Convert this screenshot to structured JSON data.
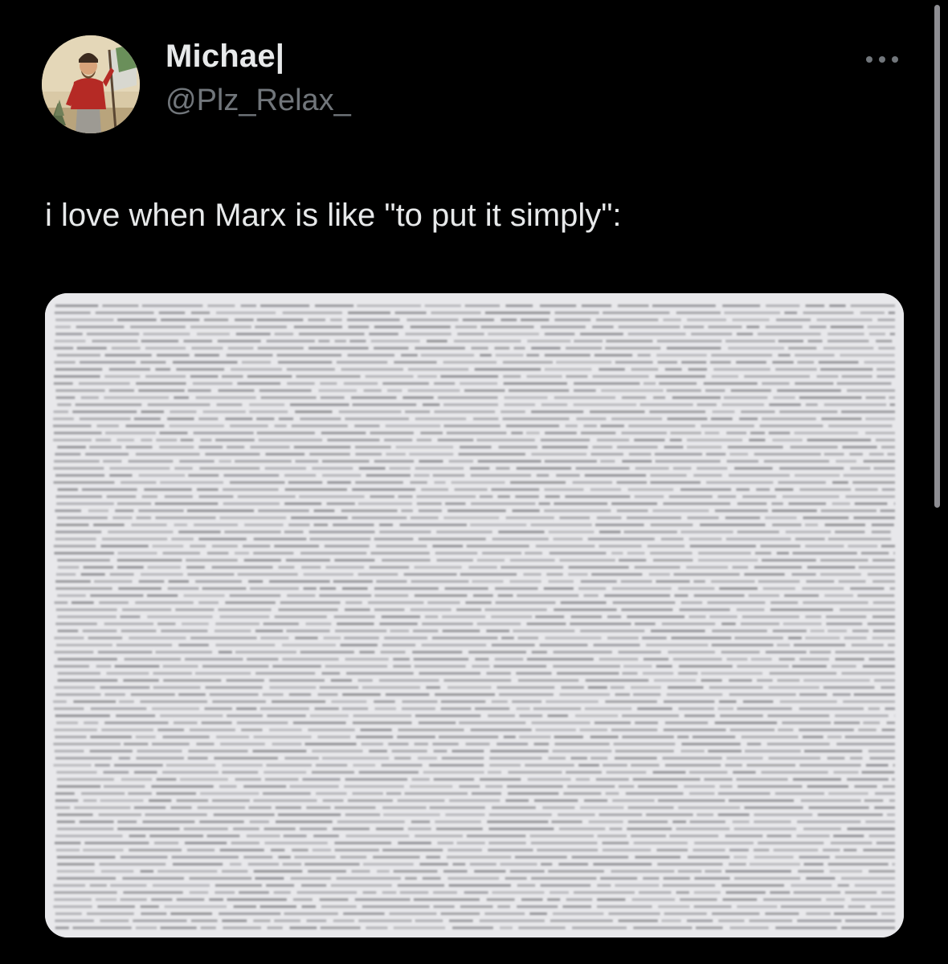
{
  "tweet": {
    "author": {
      "display_name": "Michae|",
      "handle": "@Plz_Relax_",
      "avatar_icon": "portrait-avatar"
    },
    "more_icon": "more-horizontal-icon",
    "text": "i love when Marx is like \"to put it simply\":",
    "media": {
      "description_icon": "dense-text-page-image"
    }
  },
  "colors": {
    "background": "#000000",
    "primary_text": "#e7e9ea",
    "secondary_text": "#71767b",
    "media_background": "#e7e7ea"
  }
}
